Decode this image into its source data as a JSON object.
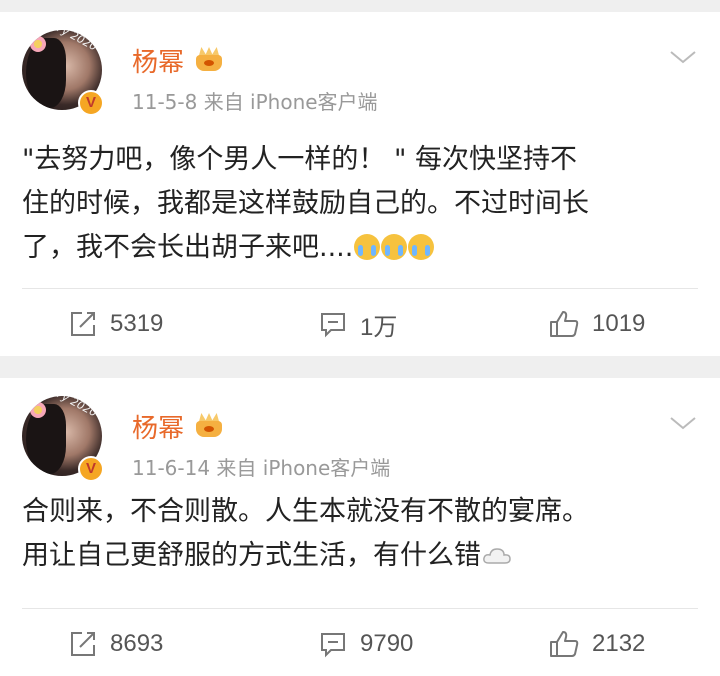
{
  "posts": [
    {
      "author": "杨幂",
      "meta": "11-5-8  来自 iPhone客户端",
      "text_line1": "\"去努力吧，像个男人一样的！ \" 每次快坚持不",
      "text_line2": "住的时候，我都是这样鼓励自己的。不过时间长",
      "text_line3": "了，我不会长出胡子来吧....",
      "emojis": [
        "crying-face",
        "crying-face",
        "crying-face"
      ],
      "reposts": "5319",
      "comments": "1万",
      "likes": "1019"
    },
    {
      "author": "杨幂",
      "meta": "11-6-14  来自 iPhone客户端",
      "text_line1": "合则来，不合则散。人生本就没有不散的宴席。",
      "text_line2": "用让自己更舒服的方式生活，有什么错",
      "emojis": [
        "cloud"
      ],
      "reposts": "8693",
      "comments": "9790",
      "likes": "2132"
    }
  ],
  "avatar_caption": "Yy 2020",
  "verified_badge": "V",
  "colors": {
    "author_name": "#e8692a",
    "meta": "#999999",
    "badge": "#f5a623"
  }
}
